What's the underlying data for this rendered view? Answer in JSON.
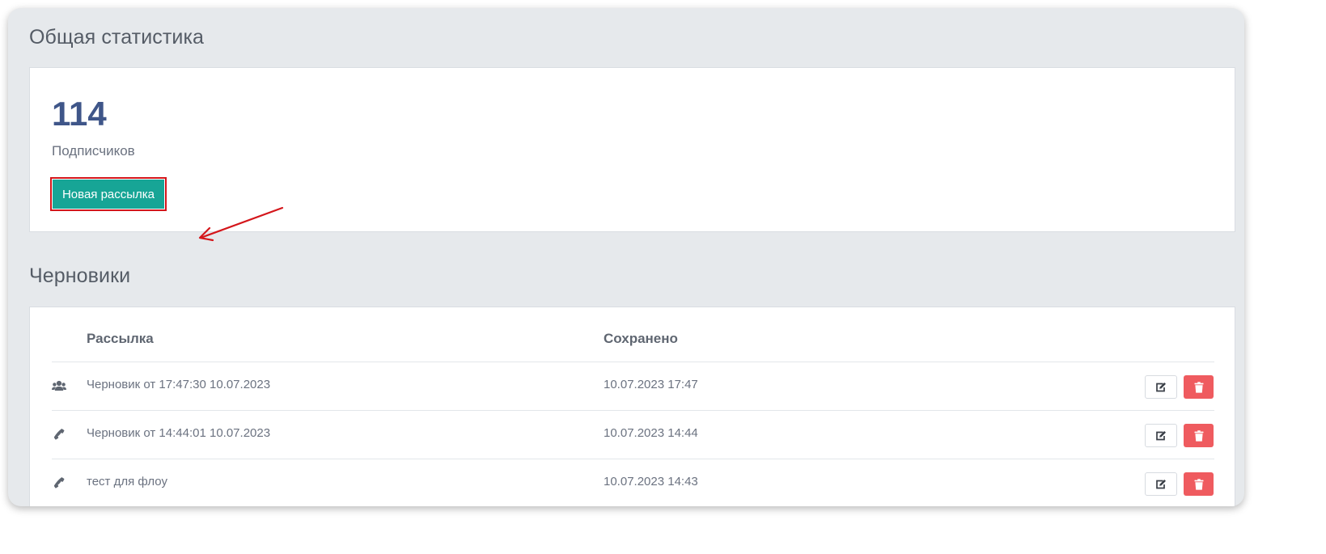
{
  "stats": {
    "title": "Общая статистика",
    "subscribers_count": "114",
    "subscribers_label": "Подписчиков",
    "new_mailing_label": "Новая рассылка"
  },
  "drafts": {
    "title": "Черновики",
    "columns": [
      "Рассылка",
      "Сохранено"
    ],
    "rows": [
      {
        "icon": "users-icon",
        "name": "Черновик от 17:47:30 10.07.2023",
        "saved": "10.07.2023 17:47"
      },
      {
        "icon": "phone-icon",
        "name": "Черновик от 14:44:01 10.07.2023",
        "saved": "10.07.2023 14:44"
      },
      {
        "icon": "phone-icon",
        "name": "тест для флоу",
        "saved": "10.07.2023 14:43"
      }
    ],
    "actions": {
      "edit_icon": "edit-icon",
      "delete_icon": "trash-icon"
    }
  },
  "colors": {
    "primary_button": "#17a596",
    "delete_button": "#ef5b5f",
    "big_number": "#3f5689",
    "annotation": "#d4161b",
    "panel_background": "#e6e9ec"
  }
}
